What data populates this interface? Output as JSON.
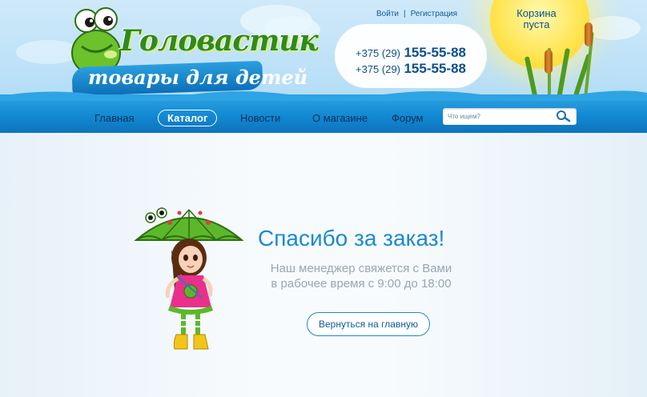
{
  "header": {
    "logo_title": "Головастик",
    "logo_subtitle": "товары для детей",
    "login_label": "Войти",
    "separator": "|",
    "register_label": "Регистрация",
    "phones": [
      {
        "code": "+375 (29)",
        "number": "155-55-88"
      },
      {
        "code": "+375 (29)",
        "number": "155-55-88"
      }
    ],
    "cart_line1": "Корзина",
    "cart_line2": "пуста"
  },
  "nav": {
    "items": [
      {
        "label": "Главная",
        "active": false
      },
      {
        "label": "Каталог",
        "active": true
      },
      {
        "label": "Новости",
        "active": false
      },
      {
        "label": "О магазине",
        "active": false
      },
      {
        "label": "Форум",
        "active": false
      }
    ],
    "search_placeholder": "Что ищем?"
  },
  "main": {
    "title": "Спасибо за заказ!",
    "message_line1": "Наш менеджер свяжется с Вами",
    "message_line2": "в рабочее время с 9:00 до 18:00",
    "back_button": "Вернуться на главную"
  },
  "colors": {
    "accent": "#1a8ad0",
    "nav_blue": "#1389d3",
    "text_dark": "#0b2f57",
    "logo_green": "#2f8a1f"
  },
  "icons": {
    "search": "magnifier-icon",
    "mascot": "frog-icon",
    "illustration": "girl-with-umbrella"
  }
}
